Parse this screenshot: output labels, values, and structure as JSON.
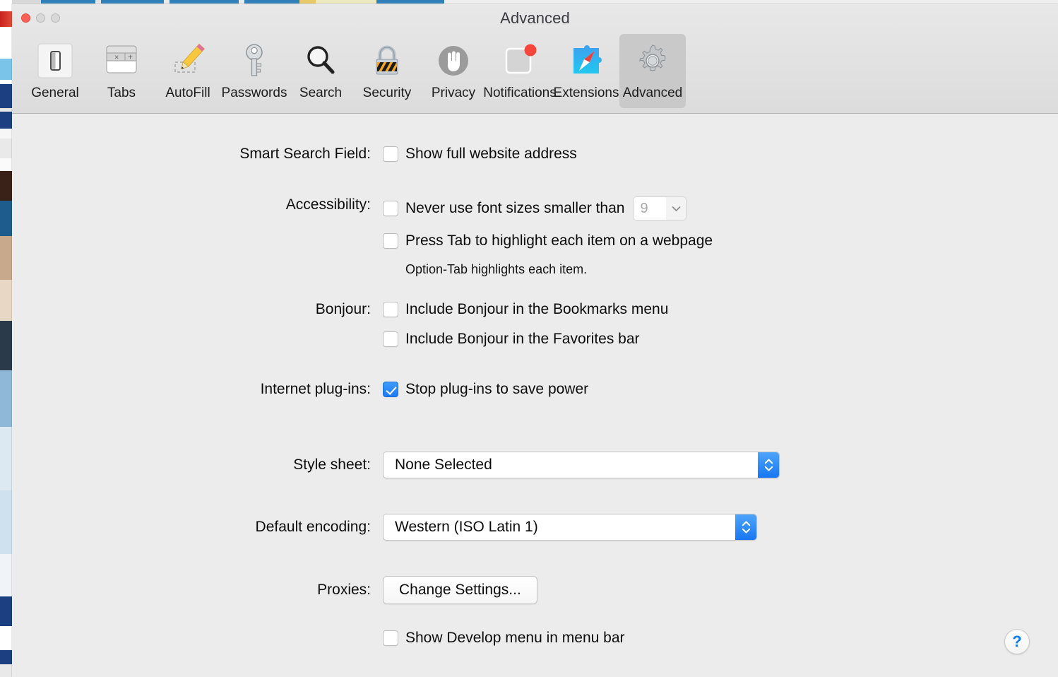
{
  "window": {
    "title": "Advanced",
    "traffic_lights": [
      "close",
      "minimize",
      "zoom"
    ]
  },
  "toolbar": {
    "items": [
      {
        "label": "General",
        "icon": "general-switch-icon",
        "selected": false
      },
      {
        "label": "Tabs",
        "icon": "tabs-icon",
        "selected": false
      },
      {
        "label": "AutoFill",
        "icon": "autofill-pencil-icon",
        "selected": false
      },
      {
        "label": "Passwords",
        "icon": "key-icon",
        "selected": false
      },
      {
        "label": "Search",
        "icon": "magnifier-icon",
        "selected": false
      },
      {
        "label": "Security",
        "icon": "padlock-icon",
        "selected": false
      },
      {
        "label": "Privacy",
        "icon": "hand-icon",
        "selected": false
      },
      {
        "label": "Notifications",
        "icon": "notification-badge-icon",
        "selected": false
      },
      {
        "label": "Extensions",
        "icon": "puzzle-compass-icon",
        "selected": false
      },
      {
        "label": "Advanced",
        "icon": "gear-icon",
        "selected": true
      }
    ]
  },
  "settings": {
    "smart_search_field": {
      "label": "Smart Search Field:",
      "show_full_address": {
        "text": "Show full website address",
        "checked": false
      }
    },
    "accessibility": {
      "label": "Accessibility:",
      "min_font_size": {
        "text": "Never use font sizes smaller than",
        "checked": false,
        "value": "9",
        "chevron": "chevron-down-icon"
      },
      "press_tab": {
        "text": "Press Tab to highlight each item on a webpage",
        "checked": false
      },
      "hint": "Option-Tab highlights each item."
    },
    "bonjour": {
      "label": "Bonjour:",
      "bookmarks_menu": {
        "text": "Include Bonjour in the Bookmarks menu",
        "checked": false
      },
      "favorites_bar": {
        "text": "Include Bonjour in the Favorites bar",
        "checked": false
      }
    },
    "internet_plugins": {
      "label": "Internet plug-ins:",
      "stop_plugins": {
        "text": "Stop plug-ins to save power",
        "checked": true
      }
    },
    "style_sheet": {
      "label": "Style sheet:",
      "value": "None Selected"
    },
    "default_encoding": {
      "label": "Default encoding:",
      "value": "Western (ISO Latin 1)"
    },
    "proxies": {
      "label": "Proxies:",
      "button": "Change Settings..."
    },
    "develop_menu": {
      "text": "Show Develop menu in menu bar",
      "checked": false
    }
  },
  "help": {
    "glyph": "?"
  },
  "colors": {
    "accent_blue": "#1b7cf5",
    "popup_arrow_blue": "#1877f2",
    "help_blue": "#0a7bfb",
    "window_bg": "#ececec",
    "toolbar_selected": "#c9c9c9",
    "close_red": "#fc6058"
  }
}
